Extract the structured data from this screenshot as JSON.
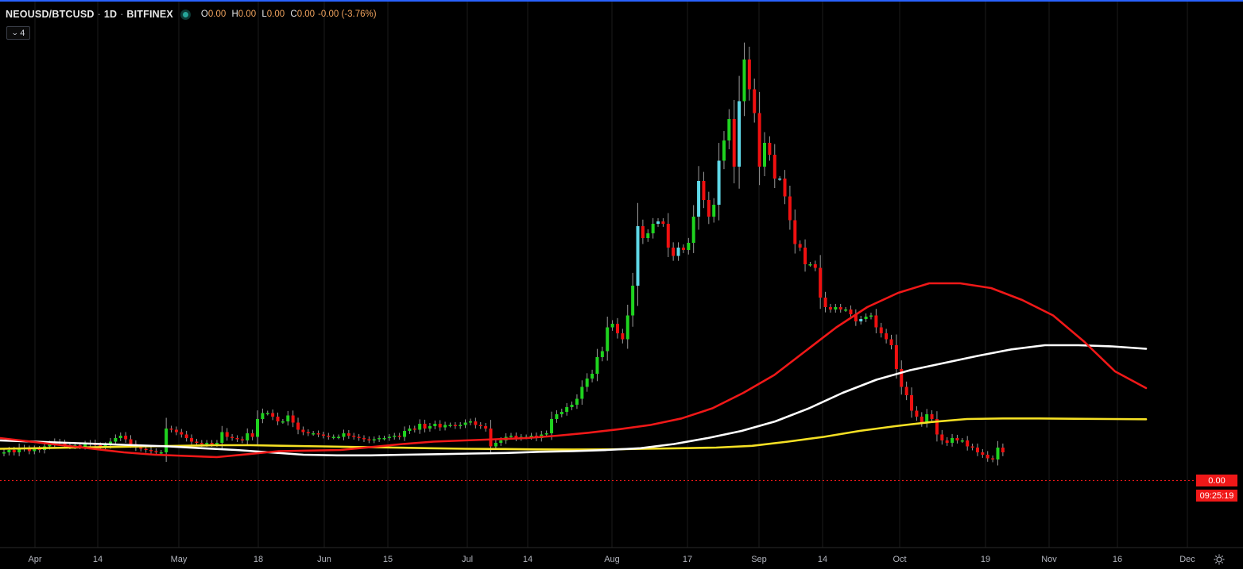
{
  "legend": {
    "symbol": "NEOUSD/BTCUSD",
    "interval": "1D",
    "exchange": "BITFINEX",
    "open_key": "O",
    "open": "0.00",
    "high_key": "H",
    "high": "0.00",
    "low_key": "L",
    "low": "0.00",
    "close_key": "C",
    "close": "0.00",
    "change": "-0.00 (-3.76%)",
    "dot": "·",
    "collapse_count": "4",
    "collapse_icon": "chevron-down-icon"
  },
  "price_axis": {
    "last_price": "0.00",
    "countdown": "09:25:19",
    "tag_color": "#f01818"
  },
  "time_axis": {
    "labels": [
      "Apr",
      "14",
      "May",
      "18",
      "Jun",
      "15",
      "Jul",
      "14",
      "Aug",
      "17",
      "Sep",
      "14",
      "Oct",
      "19",
      "Nov",
      "16",
      "Dec"
    ]
  },
  "colors": {
    "up": "#1fd31f",
    "up_hollow": "#5fd8e8",
    "down": "#f01010",
    "ma_fast": "#f01818",
    "ma_mid": "#ffffff",
    "ma_slow": "#f5e024",
    "grid": "#1c1c1c",
    "link_border": "#2962ff"
  },
  "chart_data": {
    "type": "candlestick",
    "pair": "NEOUSD/BTCUSD",
    "timeframe": "1D",
    "x_start": "2020-03-24",
    "x_end": "2020-11-22",
    "relative_scale_note": "",
    "closes": [
      1.0,
      1.02,
      1.0,
      1.04,
      1.03,
      1.01,
      1.03,
      1.02,
      1.05,
      1.07,
      1.09,
      1.08,
      1.06,
      1.05,
      1.06,
      1.05,
      1.07,
      1.08,
      1.06,
      1.05,
      1.06,
      1.09,
      1.12,
      1.14,
      1.11,
      1.07,
      1.04,
      1.03,
      1.02,
      1.01,
      1.0,
      1.0,
      1.2,
      1.19,
      1.17,
      1.15,
      1.12,
      1.09,
      1.08,
      1.07,
      1.08,
      1.07,
      1.08,
      1.17,
      1.13,
      1.12,
      1.11,
      1.1,
      1.16,
      1.13,
      1.28,
      1.33,
      1.33,
      1.3,
      1.26,
      1.26,
      1.31,
      1.25,
      1.19,
      1.17,
      1.16,
      1.16,
      1.15,
      1.14,
      1.13,
      1.13,
      1.13,
      1.16,
      1.14,
      1.13,
      1.12,
      1.11,
      1.1,
      1.11,
      1.12,
      1.12,
      1.13,
      1.14,
      1.13,
      1.18,
      1.2,
      1.19,
      1.24,
      1.2,
      1.22,
      1.24,
      1.21,
      1.23,
      1.23,
      1.22,
      1.23,
      1.25,
      1.26,
      1.23,
      1.22,
      1.2,
      1.05,
      1.08,
      1.1,
      1.13,
      1.14,
      1.12,
      1.13,
      1.13,
      1.14,
      1.12,
      1.15,
      1.16,
      1.28,
      1.32,
      1.34,
      1.38,
      1.4,
      1.45,
      1.55,
      1.62,
      1.66,
      1.8,
      1.85,
      2.05,
      2.08,
      2.0,
      1.95,
      2.15,
      2.4,
      2.9,
      2.8,
      2.84,
      2.92,
      2.94,
      2.92,
      2.72,
      2.65,
      2.72,
      2.7,
      2.76,
      2.98,
      3.28,
      3.12,
      2.98,
      3.08,
      3.45,
      3.62,
      3.8,
      3.4,
      3.95,
      4.3,
      4.05,
      3.85,
      3.4,
      3.6,
      3.5,
      3.3,
      3.3,
      3.15,
      2.95,
      2.75,
      2.72,
      2.58,
      2.58,
      2.55,
      2.3,
      2.22,
      2.2,
      2.22,
      2.2,
      2.2,
      2.16,
      2.1,
      2.12,
      2.14,
      2.15,
      2.05,
      2.0,
      1.95,
      1.9,
      1.7,
      1.55,
      1.48,
      1.35,
      1.3,
      1.25,
      1.32,
      1.28,
      1.15,
      1.1,
      1.08,
      1.12,
      1.1,
      1.1,
      1.05,
      1.04,
      1.0,
      0.98,
      0.95,
      0.94,
      1.04,
      1.0
    ],
    "ma_fast_values": [
      1.12,
      1.09,
      1.06,
      1.03,
      1.0,
      0.98,
      0.97,
      0.96,
      0.985,
      1.01,
      1.015,
      1.02,
      1.045,
      1.07,
      1.09,
      1.1,
      1.11,
      1.12,
      1.14,
      1.165,
      1.195,
      1.23,
      1.285,
      1.37,
      1.5,
      1.65,
      1.85,
      2.05,
      2.22,
      2.34,
      2.42,
      2.42,
      2.38,
      2.28,
      2.15,
      1.93,
      1.68,
      1.54
    ],
    "ma_mid_values": [
      1.1,
      1.09,
      1.08,
      1.07,
      1.06,
      1.05,
      1.035,
      1.02,
      1.0,
      0.98,
      0.975,
      0.975,
      0.98,
      0.985,
      0.99,
      0.995,
      1.005,
      1.01,
      1.02,
      1.035,
      1.07,
      1.12,
      1.18,
      1.26,
      1.37,
      1.5,
      1.61,
      1.69,
      1.75,
      1.81,
      1.865,
      1.9,
      1.9,
      1.89,
      1.87
    ],
    "ma_slow_values": [
      1.03,
      1.035,
      1.04,
      1.045,
      1.05,
      1.055,
      1.06,
      1.06,
      1.055,
      1.05,
      1.045,
      1.04,
      1.035,
      1.03,
      1.028,
      1.025,
      1.024,
      1.025,
      1.03,
      1.035,
      1.04,
      1.055,
      1.09,
      1.13,
      1.18,
      1.22,
      1.255,
      1.28,
      1.285,
      1.285,
      1.282,
      1.28,
      1.278
    ]
  }
}
